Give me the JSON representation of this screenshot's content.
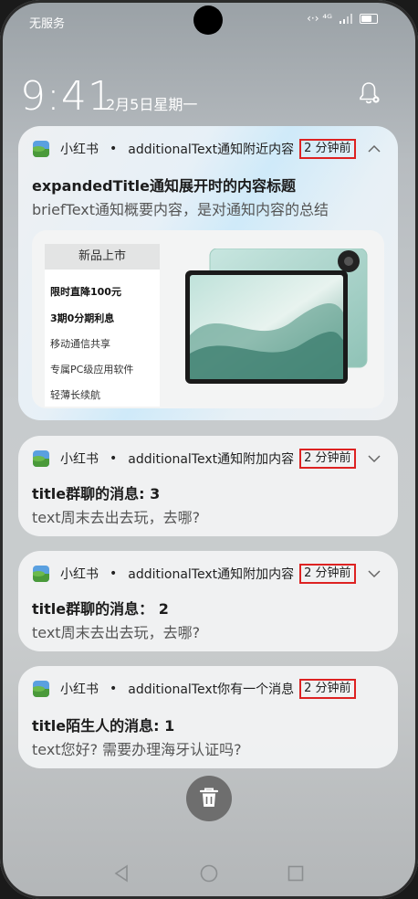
{
  "status": {
    "carrier": "无服务",
    "signal_text": "‹·› ⁴ᴳ"
  },
  "lock": {
    "time": "9:41",
    "date": "2月5日星期一"
  },
  "notifications": [
    {
      "app": "小红书",
      "separator": "•",
      "additional": "additionalText通知附近内容",
      "time": "2 分钟前",
      "expanded": true,
      "title": "expandedTitle通知展开时的内容标题",
      "text": "briefText通知概要内容，是对通知内容的总结",
      "image": {
        "header": "新品上市",
        "lines": [
          "限时直降100元",
          "3期0分期利息",
          "移动通信共享",
          "专属PC级应用软件",
          "轻薄长续航"
        ]
      }
    },
    {
      "app": "小红书",
      "separator": "•",
      "additional": "additionalText通知附加内容",
      "time": "2 分钟前",
      "title": "title群聊的消息: 3",
      "text": "text周末去出去玩，去哪?"
    },
    {
      "app": "小红书",
      "separator": "•",
      "additional": "additionalText通知附加内容",
      "time": "2 分钟前",
      "title": "title群聊的消息： 2",
      "text": "text周末去出去玩，去哪?"
    },
    {
      "app": "小红书",
      "separator": "•",
      "additional": "additionalText你有一个消息",
      "time": "2 分钟前",
      "title": "title陌生人的消息: 1",
      "text": "text您好? 需要办理海牙认证吗?"
    }
  ],
  "icons": {
    "bell": "bell-settings-icon",
    "trash": "trash-icon",
    "nav_back": "back-triangle-icon",
    "nav_home": "home-circle-icon",
    "nav_recent": "recent-square-icon"
  },
  "colors": {
    "time_border": "#dd2222"
  }
}
